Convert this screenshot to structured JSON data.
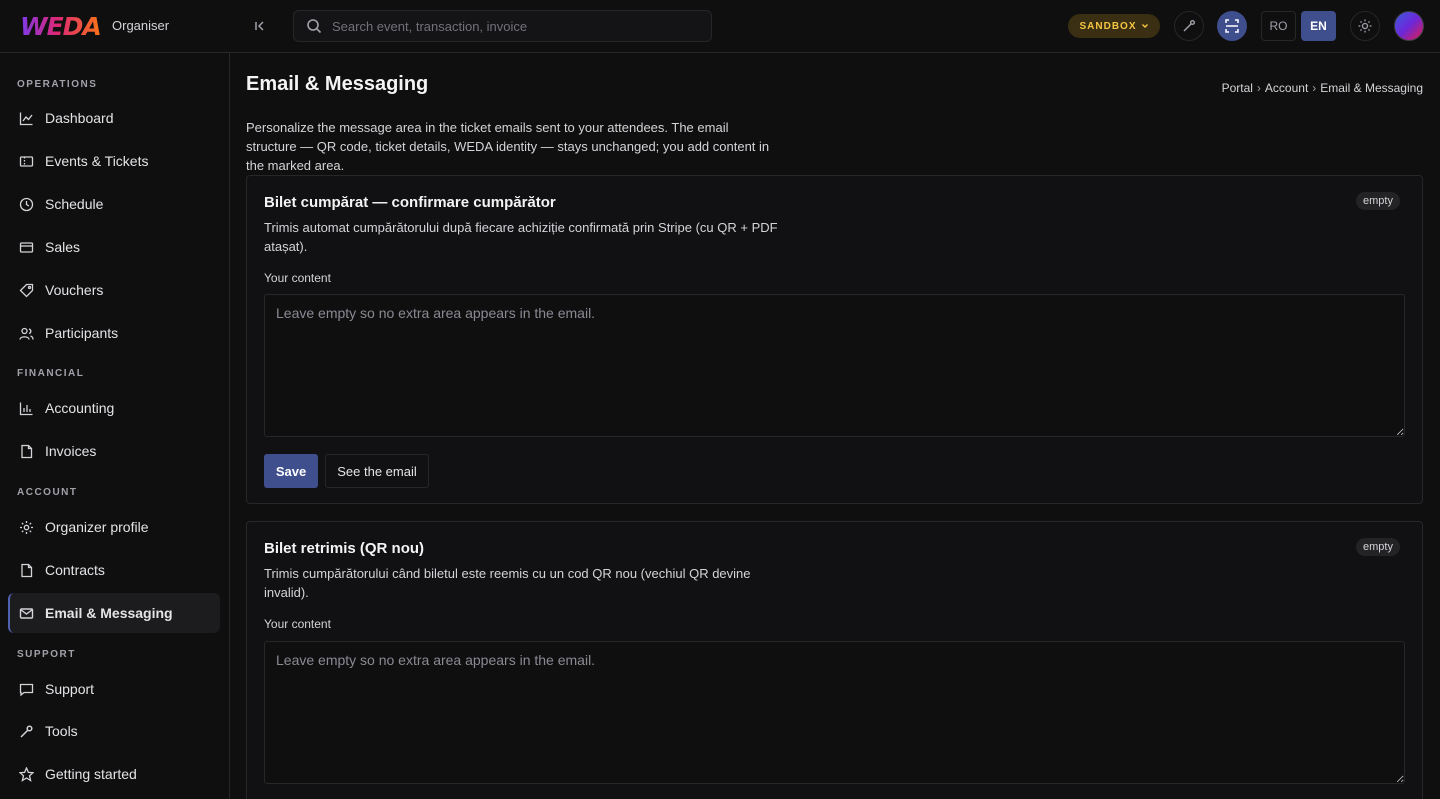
{
  "header": {
    "logo_text": "WEDA",
    "org_label": "Organiser",
    "search_placeholder": "Search event, transaction, invoice",
    "env_badge": "SANDBOX",
    "lang_ro": "RO",
    "lang_en": "EN"
  },
  "sidebar": {
    "sections": {
      "operations": "OPERATIONS",
      "financial": "FINANCIAL",
      "account": "ACCOUNT",
      "support": "SUPPORT"
    },
    "items": {
      "dashboard": "Dashboard",
      "events": "Events & Tickets",
      "schedule": "Schedule",
      "sales": "Sales",
      "vouchers": "Vouchers",
      "participants": "Participants",
      "accounting": "Accounting",
      "invoices": "Invoices",
      "organizer_profile": "Organizer profile",
      "contracts": "Contracts",
      "email_messaging": "Email & Messaging",
      "support": "Support",
      "tools": "Tools",
      "getting_started": "Getting started"
    }
  },
  "main": {
    "title": "Email & Messaging",
    "breadcrumb": [
      "Portal",
      "Account",
      "Email & Messaging"
    ],
    "breadcrumb_sep": "›",
    "intro": "Personalize the message area in the ticket emails sent to your attendees. The email structure — QR code, ticket details, WEDA identity — stays unchanged; you add content in the marked area.",
    "cards": [
      {
        "title": "Bilet cumpărat — confirmare cumpărător",
        "description": "Trimis automat cumpărătorului după fiecare achiziție confirmată prin Stripe (cu QR + PDF atașat).",
        "badge": "empty",
        "field_label": "Your content",
        "value": "",
        "placeholder": "Leave empty so no extra area appears in the email.",
        "save_label": "Save",
        "preview_label": "See the email"
      },
      {
        "title": "Bilet retrimis (QR nou)",
        "description": "Trimis cumpărătorului când biletul este reemis cu un cod QR nou (vechiul QR devine invalid).",
        "badge": "empty",
        "field_label": "Your content",
        "value": "",
        "placeholder": "Leave empty so no extra area appears in the email."
      }
    ]
  },
  "colors": {
    "accent": "#3f4e8c",
    "sandbox_bg": "#3a2f12",
    "sandbox_text": "#f5c542",
    "background": "#0f0f10",
    "border": "#27272a"
  }
}
